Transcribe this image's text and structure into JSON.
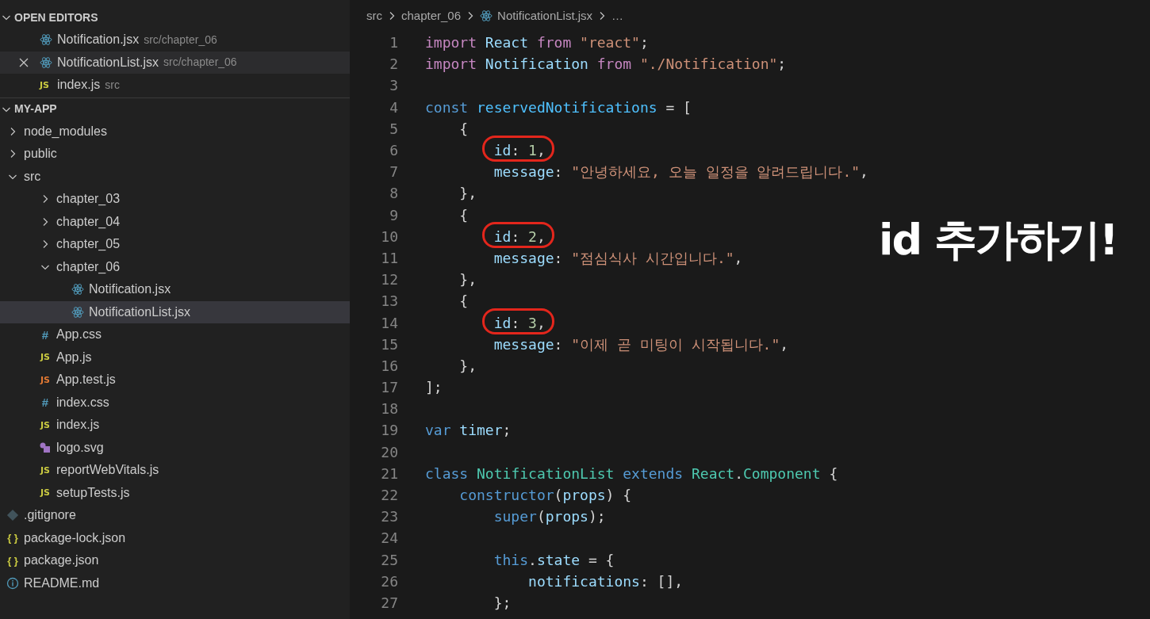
{
  "open_editors": {
    "title": "OPEN EDITORS",
    "expanded": true,
    "items": [
      {
        "name": "Notification.jsx",
        "path": "src/chapter_06",
        "kind": "react",
        "selected": false
      },
      {
        "name": "NotificationList.jsx",
        "path": "src/chapter_06",
        "kind": "react",
        "selected": true
      },
      {
        "name": "index.js",
        "path": "src",
        "kind": "js",
        "badge": "JS",
        "selected": false
      }
    ]
  },
  "project": {
    "title": "MY-APP",
    "expanded": true,
    "children": [
      {
        "name": "node_modules",
        "kind": "folder",
        "expanded": false,
        "selected": false
      },
      {
        "name": "public",
        "kind": "folder",
        "expanded": false,
        "selected": false
      },
      {
        "name": "src",
        "kind": "folder",
        "expanded": true,
        "selected": false,
        "children": [
          {
            "name": "chapter_03",
            "kind": "folder",
            "expanded": false,
            "selected": false
          },
          {
            "name": "chapter_04",
            "kind": "folder",
            "expanded": false,
            "selected": false
          },
          {
            "name": "chapter_05",
            "kind": "folder",
            "expanded": false,
            "selected": false
          },
          {
            "name": "chapter_06",
            "kind": "folder",
            "expanded": true,
            "selected": false,
            "children": [
              {
                "name": "Notification.jsx",
                "kind": "react",
                "selected": false
              },
              {
                "name": "NotificationList.jsx",
                "kind": "react",
                "selected": true
              }
            ]
          },
          {
            "name": "App.css",
            "kind": "css",
            "badge": "#",
            "selected": false
          },
          {
            "name": "App.js",
            "kind": "js",
            "badge": "JS",
            "selected": false
          },
          {
            "name": "App.test.js",
            "kind": "test",
            "badge": "JS",
            "selected": false
          },
          {
            "name": "index.css",
            "kind": "css",
            "badge": "#",
            "selected": false
          },
          {
            "name": "index.js",
            "kind": "js",
            "badge": "JS",
            "selected": false
          },
          {
            "name": "logo.svg",
            "kind": "svg",
            "selected": false
          },
          {
            "name": "reportWebVitals.js",
            "kind": "js",
            "badge": "JS",
            "selected": false
          },
          {
            "name": "setupTests.js",
            "kind": "js",
            "badge": "JS",
            "selected": false
          }
        ]
      },
      {
        "name": ".gitignore",
        "kind": "git",
        "selected": false
      },
      {
        "name": "package-lock.json",
        "kind": "json",
        "badge": "{ }",
        "selected": false
      },
      {
        "name": "package.json",
        "kind": "json",
        "badge": "{ }",
        "selected": false
      },
      {
        "name": "README.md",
        "kind": "info",
        "selected": false
      }
    ]
  },
  "breadcrumb": [
    {
      "text": "src",
      "kind": "folder"
    },
    {
      "text": "chapter_06",
      "kind": "folder"
    },
    {
      "text": "NotificationList.jsx",
      "kind": "react"
    },
    {
      "text": "…",
      "kind": "symbol"
    }
  ],
  "code": [
    {
      "number": "1",
      "circled": false,
      "tokens": [
        {
          "kind": "kw",
          "text": "import "
        },
        {
          "kind": "var",
          "text": "React "
        },
        {
          "kind": "kw",
          "text": "from "
        },
        {
          "kind": "str",
          "text": "\"react\""
        },
        {
          "kind": "p",
          "text": ";"
        }
      ]
    },
    {
      "number": "2",
      "circled": false,
      "tokens": [
        {
          "kind": "kw",
          "text": "import "
        },
        {
          "kind": "var",
          "text": "Notification "
        },
        {
          "kind": "kw",
          "text": "from "
        },
        {
          "kind": "str",
          "text": "\"./Notification\""
        },
        {
          "kind": "p",
          "text": ";"
        }
      ]
    },
    {
      "number": "3",
      "circled": false
    },
    {
      "number": "4",
      "circled": false,
      "tokens": [
        {
          "kind": "store",
          "text": "const "
        },
        {
          "kind": "const",
          "text": "reservedNotifications"
        },
        {
          "kind": "p",
          "text": " = ["
        }
      ]
    },
    {
      "number": "5",
      "circled": false,
      "tokens": [
        {
          "kind": "p",
          "text": "    {"
        }
      ]
    },
    {
      "number": "6",
      "circled": true,
      "tokens": [
        {
          "kind": "var",
          "text": "        id"
        },
        {
          "kind": "p",
          "text": ": "
        },
        {
          "kind": "num",
          "text": "1"
        },
        {
          "kind": "p",
          "text": ","
        }
      ]
    },
    {
      "number": "7",
      "circled": false,
      "tokens": [
        {
          "kind": "var",
          "text": "        message"
        },
        {
          "kind": "p",
          "text": ": "
        },
        {
          "kind": "str",
          "text": "\"안녕하세요, 오늘 일정을 알려드립니다.\""
        },
        {
          "kind": "p",
          "text": ","
        }
      ]
    },
    {
      "number": "8",
      "circled": false,
      "tokens": [
        {
          "kind": "p",
          "text": "    },"
        }
      ]
    },
    {
      "number": "9",
      "circled": false,
      "tokens": [
        {
          "kind": "p",
          "text": "    {"
        }
      ]
    },
    {
      "number": "10",
      "circled": true,
      "tokens": [
        {
          "kind": "var",
          "text": "        id"
        },
        {
          "kind": "p",
          "text": ": "
        },
        {
          "kind": "num",
          "text": "2"
        },
        {
          "kind": "p",
          "text": ","
        }
      ]
    },
    {
      "number": "11",
      "circled": false,
      "tokens": [
        {
          "kind": "var",
          "text": "        message"
        },
        {
          "kind": "p",
          "text": ": "
        },
        {
          "kind": "str",
          "text": "\"점심식사 시간입니다.\""
        },
        {
          "kind": "p",
          "text": ","
        }
      ]
    },
    {
      "number": "12",
      "circled": false,
      "tokens": [
        {
          "kind": "p",
          "text": "    },"
        }
      ]
    },
    {
      "number": "13",
      "circled": false,
      "tokens": [
        {
          "kind": "p",
          "text": "    {"
        }
      ]
    },
    {
      "number": "14",
      "circled": true,
      "tokens": [
        {
          "kind": "var",
          "text": "        id"
        },
        {
          "kind": "p",
          "text": ": "
        },
        {
          "kind": "num",
          "text": "3"
        },
        {
          "kind": "p",
          "text": ","
        }
      ]
    },
    {
      "number": "15",
      "circled": false,
      "tokens": [
        {
          "kind": "var",
          "text": "        message"
        },
        {
          "kind": "p",
          "text": ": "
        },
        {
          "kind": "str",
          "text": "\"이제 곧 미팅이 시작됩니다.\""
        },
        {
          "kind": "p",
          "text": ","
        }
      ]
    },
    {
      "number": "16",
      "circled": false,
      "tokens": [
        {
          "kind": "p",
          "text": "    },"
        }
      ]
    },
    {
      "number": "17",
      "circled": false,
      "tokens": [
        {
          "kind": "p",
          "text": "];"
        }
      ]
    },
    {
      "number": "18",
      "circled": false
    },
    {
      "number": "19",
      "circled": false,
      "tokens": [
        {
          "kind": "store",
          "text": "var "
        },
        {
          "kind": "var",
          "text": "timer"
        },
        {
          "kind": "p",
          "text": ";"
        }
      ]
    },
    {
      "number": "20",
      "circled": false
    },
    {
      "number": "21",
      "circled": false,
      "tokens": [
        {
          "kind": "store",
          "text": "class "
        },
        {
          "kind": "type",
          "text": "NotificationList "
        },
        {
          "kind": "store",
          "text": "extends "
        },
        {
          "kind": "type",
          "text": "React"
        },
        {
          "kind": "p",
          "text": "."
        },
        {
          "kind": "type",
          "text": "Component"
        },
        {
          "kind": "p",
          "text": " {"
        }
      ]
    },
    {
      "number": "22",
      "circled": false,
      "tokens": [
        {
          "kind": "store",
          "text": "    constructor"
        },
        {
          "kind": "p",
          "text": "("
        },
        {
          "kind": "var",
          "text": "props"
        },
        {
          "kind": "p",
          "text": ") {"
        }
      ]
    },
    {
      "number": "23",
      "circled": false,
      "tokens": [
        {
          "kind": "store",
          "text": "        super"
        },
        {
          "kind": "p",
          "text": "("
        },
        {
          "kind": "var",
          "text": "props"
        },
        {
          "kind": "p",
          "text": ");"
        }
      ]
    },
    {
      "number": "24",
      "circled": false
    },
    {
      "number": "25",
      "circled": false,
      "tokens": [
        {
          "kind": "store",
          "text": "        this"
        },
        {
          "kind": "p",
          "text": "."
        },
        {
          "kind": "var",
          "text": "state"
        },
        {
          "kind": "p",
          "text": " = {"
        }
      ]
    },
    {
      "number": "26",
      "circled": false,
      "tokens": [
        {
          "kind": "var",
          "text": "            notifications"
        },
        {
          "kind": "p",
          "text": ": [],"
        }
      ]
    },
    {
      "number": "27",
      "circled": false,
      "tokens": [
        {
          "kind": "p",
          "text": "        };"
        }
      ]
    }
  ],
  "caption": "id 추가하기!"
}
